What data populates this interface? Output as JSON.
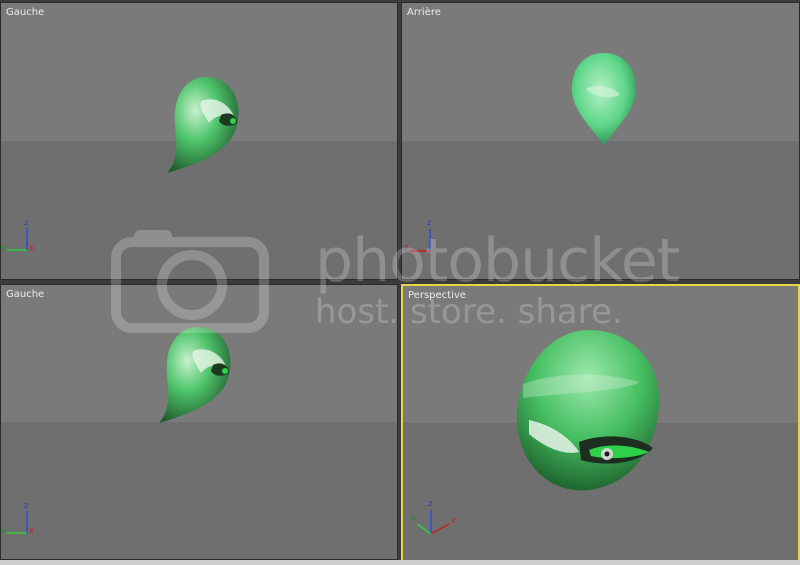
{
  "viewports": [
    {
      "label": "Gauche"
    },
    {
      "label": "Arrière"
    },
    {
      "label": "Gauche"
    },
    {
      "label": "Perspective"
    }
  ],
  "active_viewport": "Perspective",
  "colors": {
    "active_border": "#e2d642",
    "model_green": "#3fbf5f",
    "viewport_bg": "#7d7d7d"
  },
  "watermark": {
    "line1": "photobucket",
    "line2": "host. store. share."
  },
  "axis_labels": {
    "x": "x",
    "y": "y",
    "z": "z"
  }
}
